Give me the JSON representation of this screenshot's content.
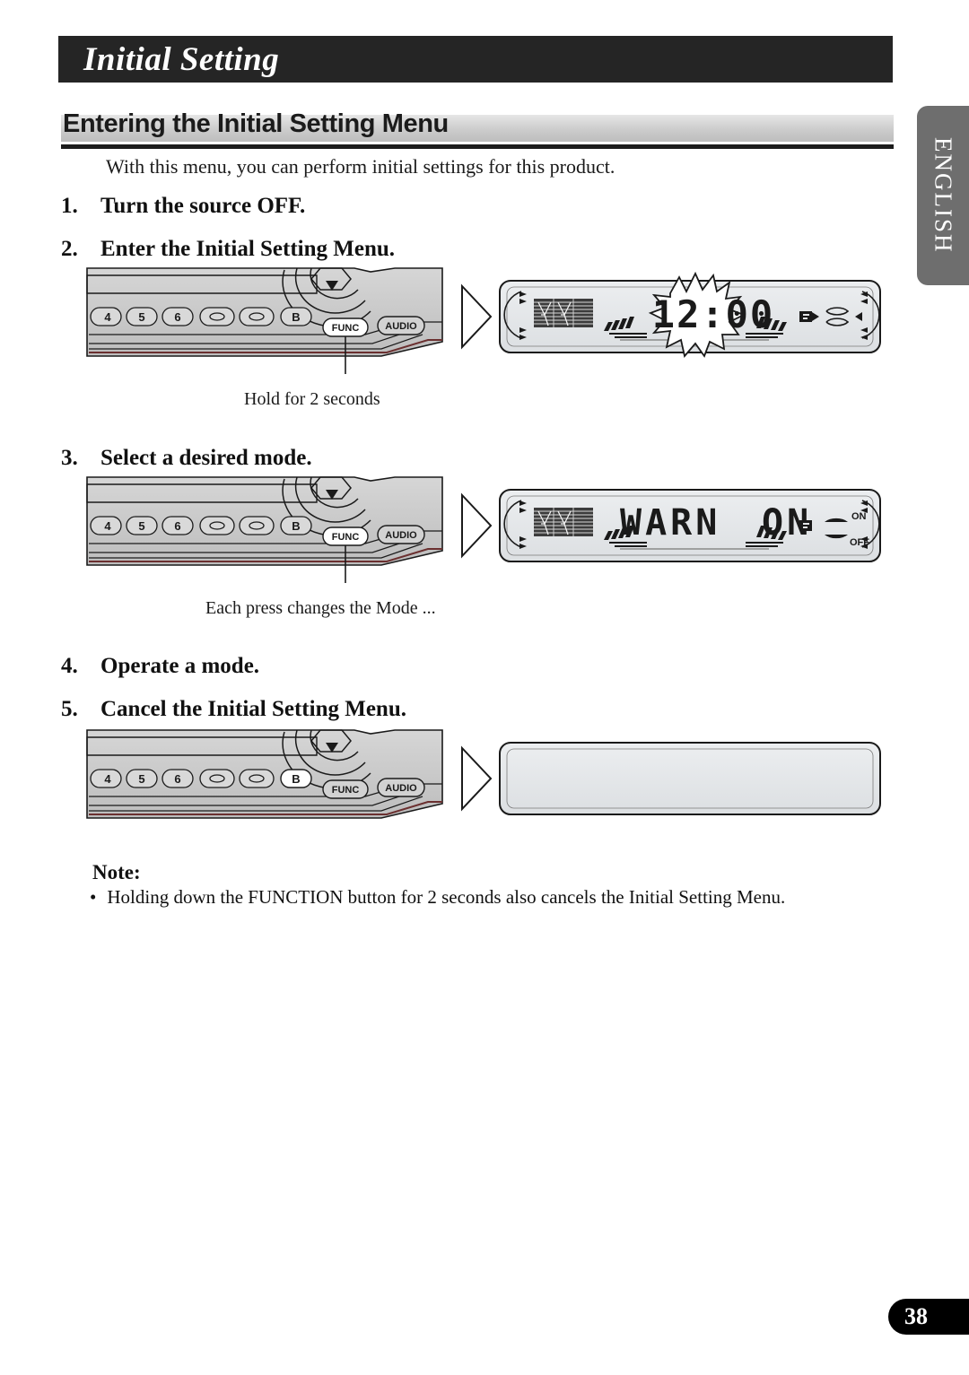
{
  "page": {
    "title": "Initial Setting",
    "language_tab": "ENGLISH",
    "page_number": "38"
  },
  "section": {
    "heading": "Entering the Initial Setting Menu",
    "intro": "With this menu, you can perform initial settings for this product."
  },
  "steps": [
    {
      "num": "1.",
      "text": "Turn the source OFF."
    },
    {
      "num": "2.",
      "text": "Enter the Initial Setting Menu."
    },
    {
      "num": "3.",
      "text": "Select a desired mode."
    },
    {
      "num": "4.",
      "text": "Operate a mode."
    },
    {
      "num": "5.",
      "text": "Cancel the Initial Setting Menu."
    }
  ],
  "captions": {
    "hold": "Hold for 2 seconds",
    "each_press": "Each press changes the Mode ..."
  },
  "device": {
    "buttons": [
      "4",
      "5",
      "6",
      "▭",
      "▭",
      "B"
    ],
    "func_label": "FUNC",
    "audio_label": "AUDIO"
  },
  "displays": {
    "first": {
      "main": "12:00",
      "blinking": true
    },
    "second": {
      "main_left": "WARN",
      "main_right": "ON",
      "ind_on": "ON",
      "ind_off": "OFF",
      "f_icon": "F"
    },
    "third": {
      "main": "",
      "blank": true
    }
  },
  "note": {
    "title": "Note:",
    "bullet": "•",
    "text": "Holding down the FUNCTION button for 2 seconds also cancels the Initial Setting Menu."
  },
  "colors": {
    "title_bar": "#252525",
    "heading_band": "#cccccc",
    "lang_tab": "#6e6e6e",
    "page_num_bg": "#000000",
    "panel_face": "#c9c9c9",
    "lcd_face": "#e4e6e8"
  }
}
